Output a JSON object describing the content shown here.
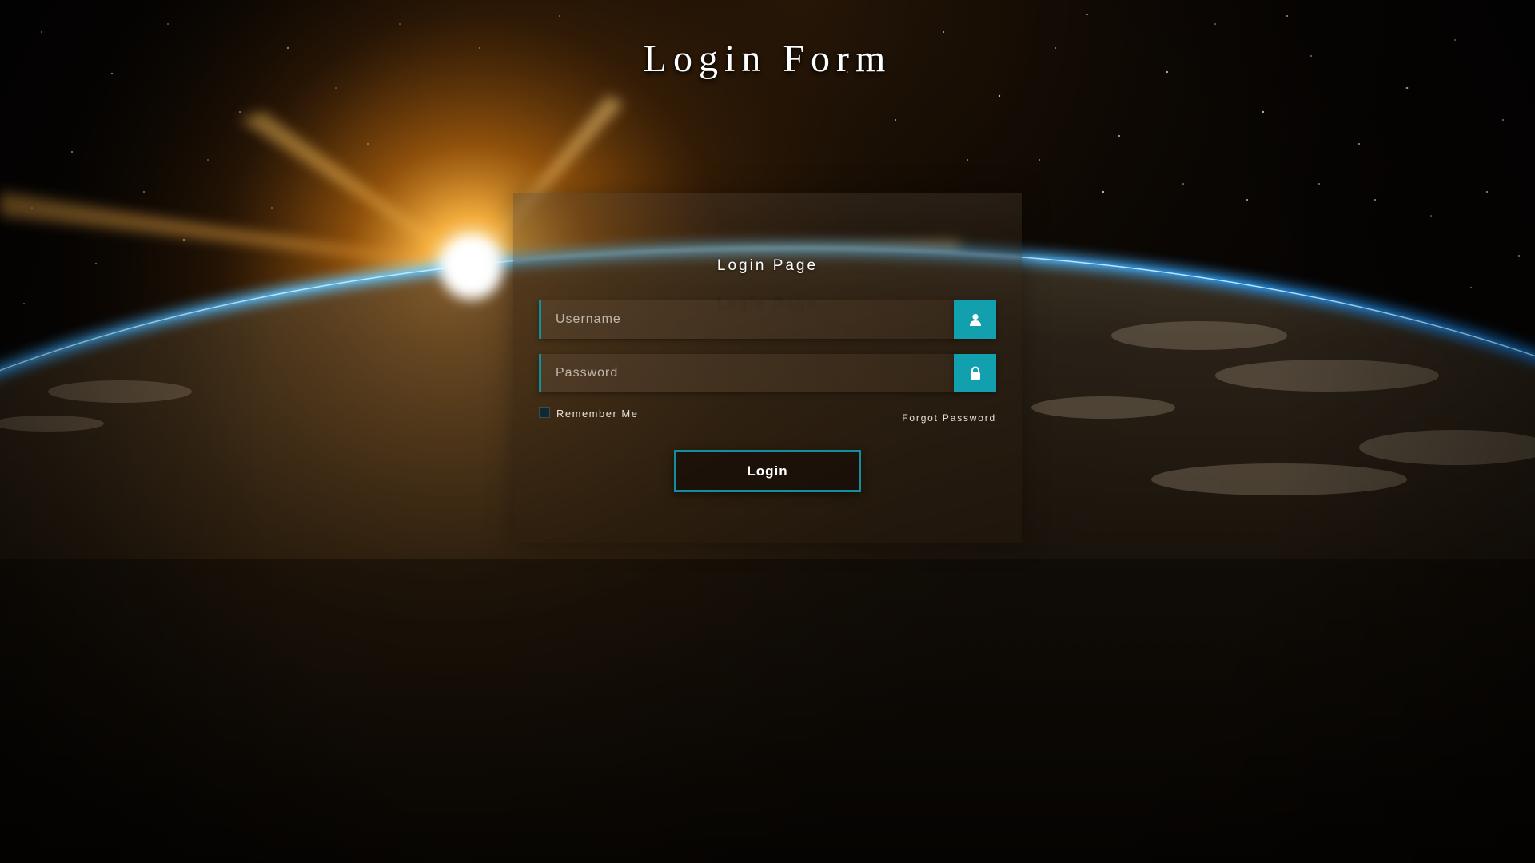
{
  "page": {
    "title": "Login Form"
  },
  "form": {
    "heading": "Login Page",
    "heading_echo": "Login Page",
    "username": {
      "placeholder": "Username",
      "value": "",
      "icon": "user-icon"
    },
    "password": {
      "placeholder": "Password",
      "value": "",
      "icon": "lock-icon"
    },
    "remember_label": "Remember Me",
    "remember_checked": false,
    "forgot_label": "Forgot Password",
    "submit_label": "Login"
  },
  "colors": {
    "accent": "#13a0ae",
    "accent_border": "#138e9c",
    "text": "#ffffff"
  }
}
